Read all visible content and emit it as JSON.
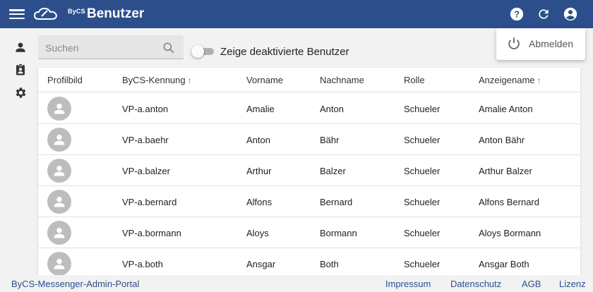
{
  "header": {
    "logo_text": "ByCS",
    "title": "Benutzer",
    "background_color": "#2c4f8c",
    "icons": [
      "menu-icon",
      "help-icon",
      "refresh-icon",
      "account-icon"
    ]
  },
  "sidebar": {
    "icons": [
      "person-icon",
      "clipboard-account-icon",
      "gear-icon"
    ]
  },
  "search": {
    "placeholder": "Suchen",
    "value": ""
  },
  "toggle": {
    "label": "Zeige deaktivierte Benutzer",
    "checked": false
  },
  "table": {
    "columns": [
      {
        "label": "Profilbild",
        "sorted": false
      },
      {
        "label": "ByCS-Kennung",
        "sorted": true,
        "direction": "asc"
      },
      {
        "label": "Vorname",
        "sorted": false
      },
      {
        "label": "Nachname",
        "sorted": false
      },
      {
        "label": "Rolle",
        "sorted": false
      },
      {
        "label": "Anzeigename",
        "sorted": true,
        "direction": "asc"
      }
    ],
    "sort_arrow": "↑",
    "rows": [
      {
        "kennung": "VP-a.anton",
        "vorname": "Amalie",
        "nachname": "Anton",
        "rolle": "Schueler",
        "anzeigename": "Amalie Anton"
      },
      {
        "kennung": "VP-a.baehr",
        "vorname": "Anton",
        "nachname": "Bähr",
        "rolle": "Schueler",
        "anzeigename": "Anton Bähr"
      },
      {
        "kennung": "VP-a.balzer",
        "vorname": "Arthur",
        "nachname": "Balzer",
        "rolle": "Schueler",
        "anzeigename": "Arthur Balzer"
      },
      {
        "kennung": "VP-a.bernard",
        "vorname": "Alfons",
        "nachname": "Bernard",
        "rolle": "Schueler",
        "anzeigename": "Alfons Bernard"
      },
      {
        "kennung": "VP-a.bormann",
        "vorname": "Aloys",
        "nachname": "Bormann",
        "rolle": "Schueler",
        "anzeigename": "Aloys Bormann"
      },
      {
        "kennung": "VP-a.both",
        "vorname": "Ansgar",
        "nachname": "Both",
        "rolle": "Schueler",
        "anzeigename": "Ansgar Both"
      }
    ]
  },
  "footer": {
    "portal_name": "ByCS-Messenger-Admin-Portal",
    "links": [
      "Impressum",
      "Datenschutz",
      "AGB",
      "Lizenz"
    ]
  },
  "dropdown": {
    "logout_label": "Abmelden",
    "icon": "power-icon"
  }
}
